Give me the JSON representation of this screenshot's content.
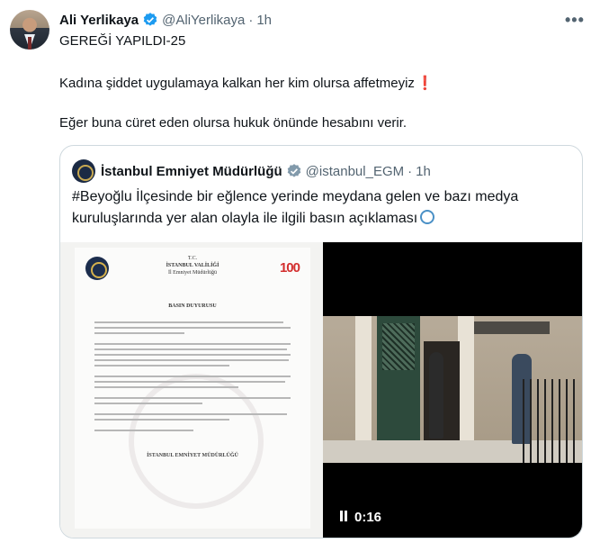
{
  "post": {
    "author_name": "Ali Yerlikaya",
    "author_handle": "@AliYerlikaya",
    "separator": "·",
    "time": "1h",
    "more_icon": "more-icon",
    "line1": "GEREĞİ YAPILDI-25",
    "line2": "Kadına şiddet uygulamaya kalkan her kim olursa affetmeyiz",
    "line2_emoji": "❗",
    "line3": "Eğer buna cüret eden olursa hukuk önünde hesabını verir."
  },
  "quote": {
    "author_name": "İstanbul Emniyet Müdürlüğü",
    "author_handle": "@istanbul_EGM",
    "separator": "·",
    "time": "1h",
    "text": "#Beyoğlu İlçesinde bir eğlence yerinde meydana gelen ve bazı medya kuruluşlarında yer alan olayla ile ilgili basın açıklaması"
  },
  "document": {
    "head_line1": "T.C.",
    "head_line2": "İSTANBUL VALİLİĞİ",
    "head_line3": "İl Emniyet Müdürlüğü",
    "title": "BASIN DUYURUSU",
    "signature": "İSTANBUL EMNİYET MÜDÜRLÜĞÜ",
    "badge": "100"
  },
  "video": {
    "duration": "0:16"
  },
  "colors": {
    "verified": "#1d9bf0",
    "secondary_text": "#536471",
    "border": "#cfd9de"
  }
}
